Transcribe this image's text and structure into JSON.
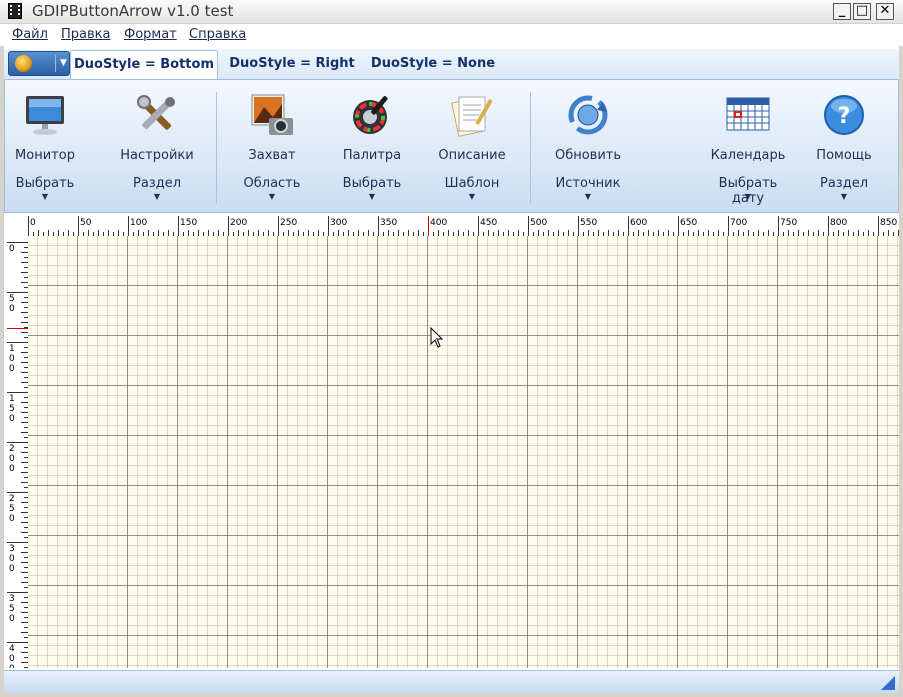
{
  "window": {
    "title": "GDIPButtonArrow v1.0 test",
    "min": "_",
    "max": "□",
    "close": "✕"
  },
  "menu": [
    "Файл",
    "Правка",
    "Формат",
    "Справка"
  ],
  "tabs": [
    "DuoStyle = Bottom",
    "DuoStyle = Right",
    "DuoStyle = None"
  ],
  "ribbon": {
    "buttons": [
      {
        "label": "Монитор",
        "sub": "Выбрать",
        "icon": "monitor-icon"
      },
      {
        "label": "Настройки",
        "sub": "Раздел",
        "icon": "tools-icon"
      },
      {
        "label": "Захват",
        "sub": "Область",
        "icon": "camera-icon"
      },
      {
        "label": "Палитра",
        "sub": "Выбрать",
        "icon": "palette-icon"
      },
      {
        "label": "Описание",
        "sub": "Шаблон",
        "icon": "document-icon"
      },
      {
        "label": "Обновить",
        "sub": "Источник",
        "icon": "refresh-icon"
      },
      {
        "label": "Календарь",
        "sub": "Выбрать дату",
        "icon": "calendar-icon"
      },
      {
        "label": "Помощь",
        "sub": "Раздел",
        "icon": "help-icon"
      }
    ],
    "dropdown_glyph": "▼"
  },
  "ruler": {
    "h_labels": [
      "0",
      "50",
      "100",
      "150",
      "200",
      "250",
      "300",
      "350",
      "400",
      "450",
      "500",
      "550",
      "600",
      "650",
      "700",
      "750",
      "800",
      "850"
    ],
    "v_labels": [
      "0",
      "50",
      "100",
      "150",
      "200",
      "250",
      "300",
      "350",
      "400"
    ],
    "marker_value": 400
  },
  "colors": {
    "accent": "#2e6fd0",
    "grid_bg": "#fdfbeb",
    "ruler_marker": "#d40000"
  }
}
